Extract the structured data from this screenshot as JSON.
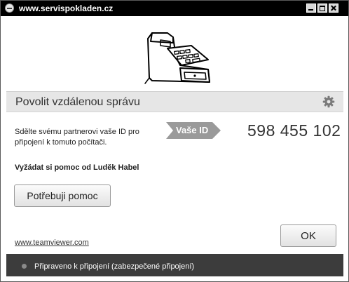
{
  "window": {
    "title": "www.servispokladen.cz",
    "icon": "teamviewer-logo-icon",
    "controls": [
      "minimize-icon",
      "maximize-icon",
      "close-icon"
    ]
  },
  "header": {
    "title": "Povolit vzdálenou správu",
    "settings_icon": "gear-icon"
  },
  "id_section": {
    "description": "Sdělte svému partnerovi vaše ID pro připojení k tomuto počítači.",
    "tag_label": "Vaše ID",
    "id_value": "598 455 102"
  },
  "help": {
    "title": "Vyžádat si pomoc od Luděk Habel",
    "button_label": "Potřebuji pomoc"
  },
  "footer": {
    "link": "www.teamviewer.com",
    "ok_label": "OK"
  },
  "status": {
    "text": "Připraveno k připojení (zabezpečené připojení)",
    "indicator_color": "#8a8a8a"
  },
  "illustration": "cash-register-icon"
}
